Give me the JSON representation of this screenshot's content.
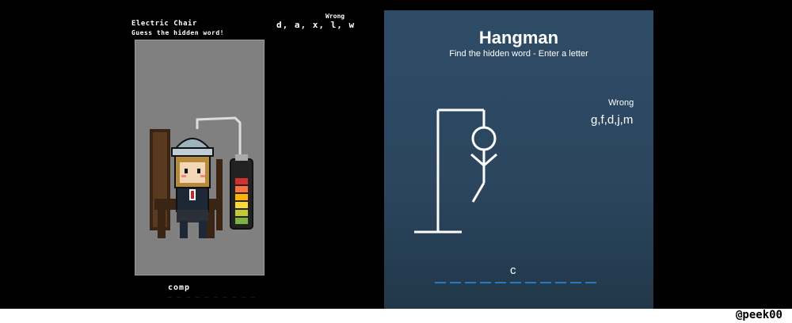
{
  "electric_chair": {
    "title": "Electric Chair",
    "subtitle": "Guess the hidden word!",
    "wrong_label": "Wrong",
    "wrong_letters": "d, a, x, l, w",
    "revealed_word": "comp",
    "remaining_dashes": "_ _ _ _ _ _ _ _ _ _",
    "battery_level": 6
  },
  "hangman": {
    "title": "Hangman",
    "subtitle": "Find the hidden word - Enter a letter",
    "wrong_label": "Wrong",
    "wrong_letters": "g,f,d,j,m",
    "guessed_letter": "c",
    "blank_count": 11
  },
  "watermark": "@peek00",
  "colors": {
    "hangman_bg": "#2f4c67",
    "blank_accent": "#2a78c2",
    "stage_gray": "#808080"
  }
}
